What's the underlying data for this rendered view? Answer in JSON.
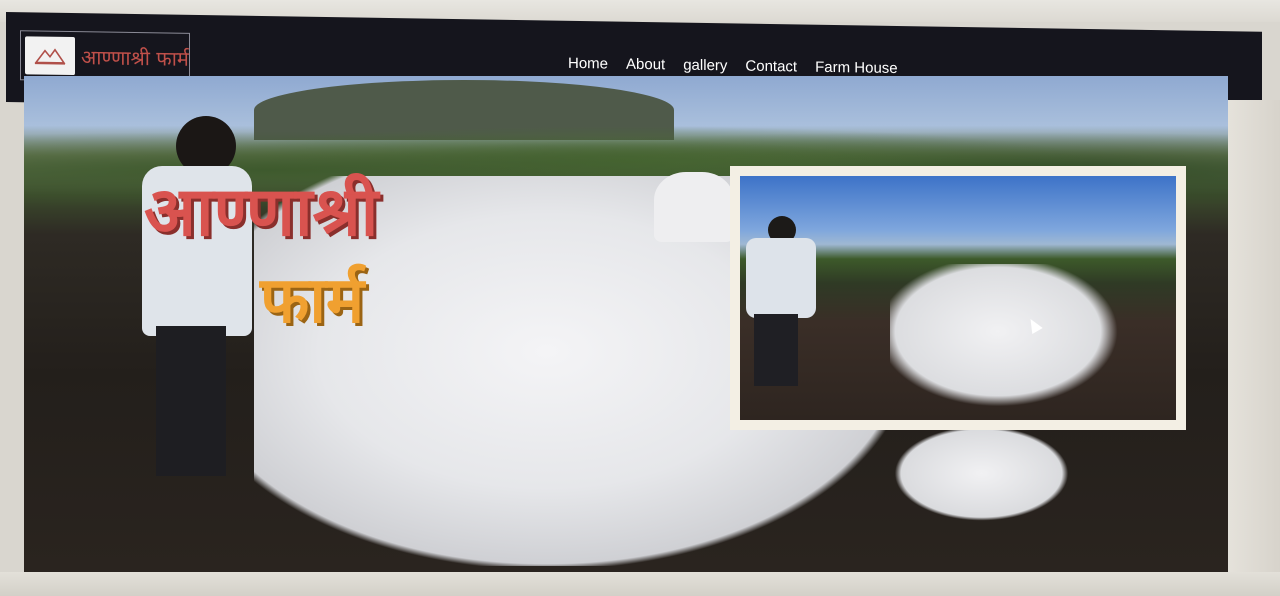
{
  "brand": {
    "logo_icon": "farm-logo-icon",
    "name": "आण्णाश्री फार्म"
  },
  "nav": {
    "links": [
      "Home",
      "About",
      "gallery",
      "Contact",
      "Farm House"
    ]
  },
  "hero": {
    "title_line1": "आण्णाश्री",
    "title_line2": "फार्म",
    "title_line1_color": "#d9534f",
    "title_line2_color": "#f0a030"
  },
  "inset": {
    "photo": "farmer-ploughing-with-ox-photo"
  },
  "colors": {
    "navbar": "#15151d",
    "nav_text": "#ffffff"
  }
}
